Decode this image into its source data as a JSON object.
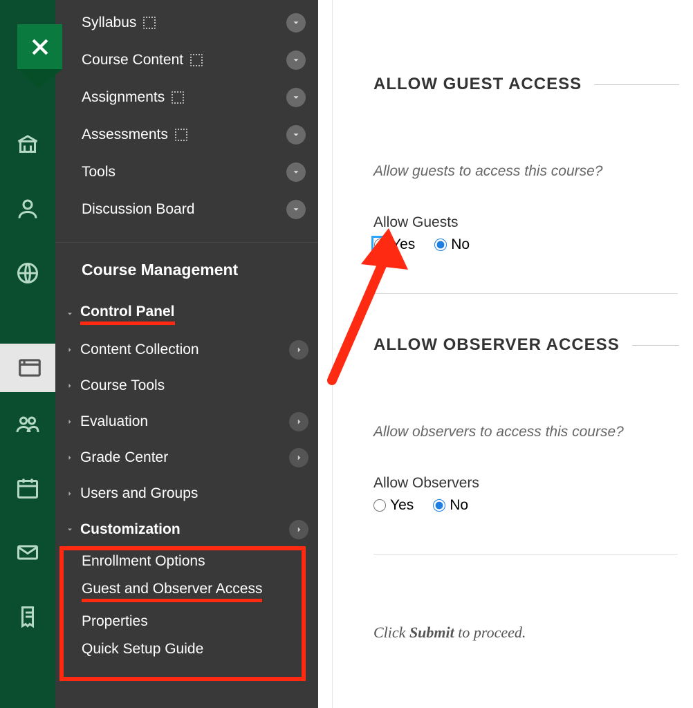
{
  "course_menu": {
    "items": [
      {
        "label": "Syllabus",
        "has_dotbox": true
      },
      {
        "label": "Course Content",
        "has_dotbox": true
      },
      {
        "label": "Assignments",
        "has_dotbox": true
      },
      {
        "label": "Assessments",
        "has_dotbox": true
      },
      {
        "label": "Tools",
        "has_dotbox": false
      },
      {
        "label": "Discussion Board",
        "has_dotbox": false
      }
    ]
  },
  "management": {
    "header": "Course Management",
    "control_panel_label": "Control Panel",
    "sections": [
      {
        "label": "Content Collection",
        "has_go": true
      },
      {
        "label": "Course Tools",
        "has_go": false
      },
      {
        "label": "Evaluation",
        "has_go": true
      },
      {
        "label": "Grade Center",
        "has_go": true
      },
      {
        "label": "Users and Groups",
        "has_go": false
      }
    ],
    "customization": {
      "label": "Customization",
      "items": [
        "Enrollment Options",
        "Guest and Observer Access",
        "Properties",
        "Quick Setup Guide"
      ]
    }
  },
  "content": {
    "guest": {
      "title": "ALLOW GUEST ACCESS",
      "desc": "Allow guests to access this course?",
      "field": "Allow Guests",
      "yes": "Yes",
      "no": "No",
      "selected": "no",
      "highlight_yes": true
    },
    "observer": {
      "title": "ALLOW OBSERVER ACCESS",
      "desc": "Allow observers to access this course?",
      "field": "Allow Observers",
      "yes": "Yes",
      "no": "No",
      "selected": "no"
    },
    "submit_note_prefix": "Click ",
    "submit_note_bold": "Submit",
    "submit_note_suffix": " to proceed."
  }
}
